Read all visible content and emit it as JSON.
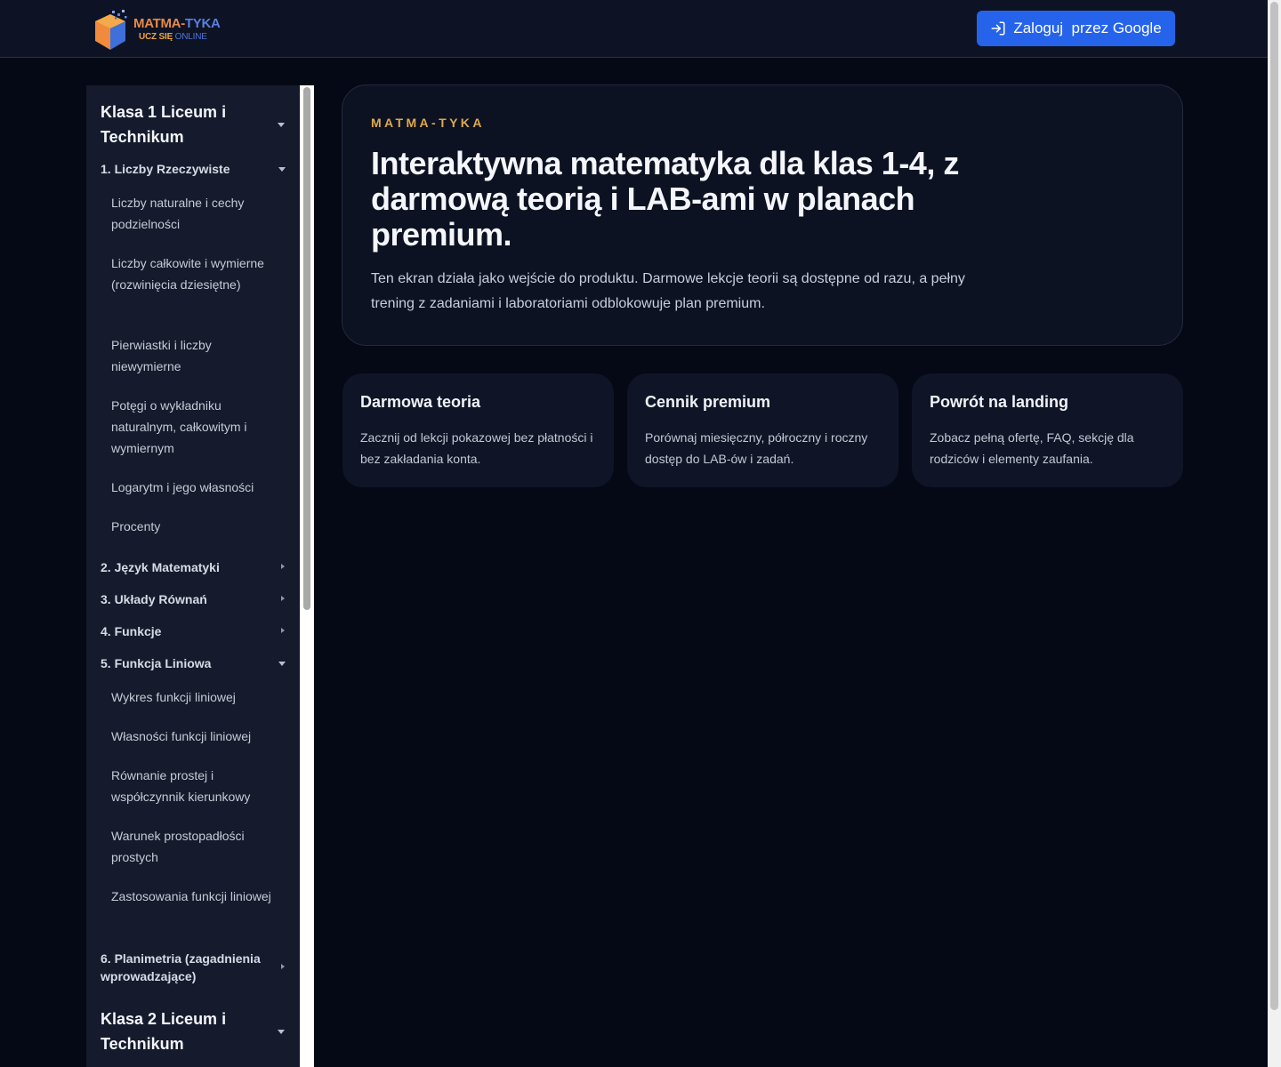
{
  "header": {
    "logo_title_a": "MATMA-",
    "logo_title_b": "TYKA",
    "logo_sub_a": "UCZ SIĘ",
    "logo_sub_b": "ONLINE",
    "login_label": "Zaloguj  przez Google"
  },
  "sidebar": {
    "grade1": "Klasa 1 Liceum i Technikum",
    "chapter1": "1. Liczby Rzeczywiste",
    "chapter1_lessons": [
      "Liczby naturalne i cechy podzielności",
      "Liczby całkowite i wymierne (rozwinięcia dziesiętne)",
      "Pierwiastki i liczby niewymierne",
      "Potęgi o wykładniku naturalnym, całkowitym i wymiernym",
      "Logarytm i jego własności",
      "Procenty"
    ],
    "chapter2": "2. Język Matematyki",
    "chapter3": "3. Układy Równań",
    "chapter4": "4. Funkcje",
    "chapter5": "5. Funkcja Liniowa",
    "chapter5_lessons": [
      "Wykres funkcji liniowej",
      "Własności funkcji liniowej",
      "Równanie prostej i współczynnik kierunkowy",
      "Warunek prostopadłości prostych",
      "Zastosowania funkcji liniowej"
    ],
    "chapter6": "6. Planimetria (zagadnienia wprowadzające)",
    "grade2": "Klasa 2 Liceum i Technikum"
  },
  "hero": {
    "eyebrow": "MATMA-TYKA",
    "title": "Interaktywna matematyka dla klas 1-4, z darmową teorią i LAB-ami w planach premium.",
    "description": "Ten ekran działa jako wejście do produktu. Darmowe lekcje teorii są dostępne od razu, a pełny trening z zadaniami i laboratoriami odblokowuje plan premium."
  },
  "cards": [
    {
      "title": "Darmowa teoria",
      "description": "Zacznij od lekcji pokazowej bez płatności i bez zakładania konta."
    },
    {
      "title": "Cennik premium",
      "description": "Porównaj miesięczny, półroczny i roczny dostęp do LAB-ów i zadań."
    },
    {
      "title": "Powrót na landing",
      "description": "Zobacz pełną ofertę, FAQ, sekcję dla rodziców i elementy zaufania."
    }
  ],
  "colors": {
    "background": "#050915",
    "accent": "#2563eb",
    "eyebrow": "#e0a84c"
  }
}
